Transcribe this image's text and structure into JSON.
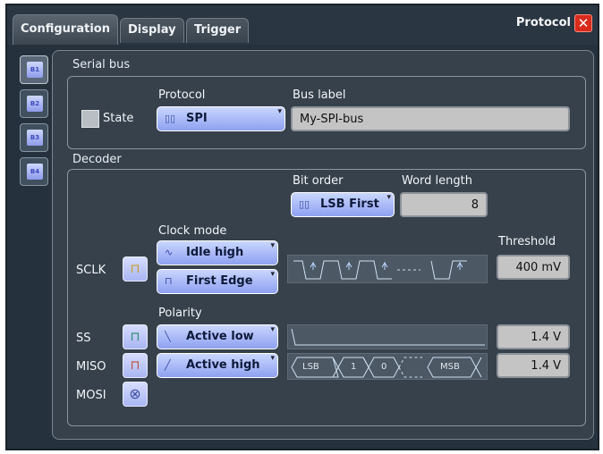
{
  "tabs": [
    {
      "label": "Configuration"
    },
    {
      "label": "Display"
    },
    {
      "label": "Trigger"
    }
  ],
  "title": "Protocol",
  "close_glyph": "✕",
  "sidebar": {
    "buttons": [
      {
        "label": "B1"
      },
      {
        "label": "B2"
      },
      {
        "label": "B3"
      },
      {
        "label": "B4"
      }
    ]
  },
  "serial_bus": {
    "section_label": "Serial bus",
    "state_label": "State",
    "state_checked": false,
    "protocol_label": "Protocol",
    "protocol_value": "SPI",
    "bus_label_label": "Bus label",
    "bus_label_value": "My-SPI-bus"
  },
  "decoder": {
    "section_label": "Decoder",
    "bit_order_label": "Bit order",
    "bit_order_value": "LSB First",
    "word_length_label": "Word length",
    "word_length_value": "8",
    "clock_mode_label": "Clock mode",
    "clock_idle_value": "Idle high",
    "clock_edge_value": "First Edge",
    "threshold_label": "Threshold",
    "sclk_label": "SCLK",
    "sclk_threshold": "400 mV",
    "polarity_label": "Polarity",
    "ss_label": "SS",
    "ss_polarity": "Active low",
    "ss_threshold": "1.4 V",
    "miso_label": "MISO",
    "miso_polarity": "Active high",
    "miso_threshold": "1.4 V",
    "mosi_label": "MOSI",
    "data_wave": {
      "lsb": "LSB",
      "one": "1",
      "zero": "0",
      "msb": "MSB"
    }
  },
  "colors": {
    "accent": "#8ea1f0",
    "close": "#d82b1c",
    "background": "#25313c"
  }
}
